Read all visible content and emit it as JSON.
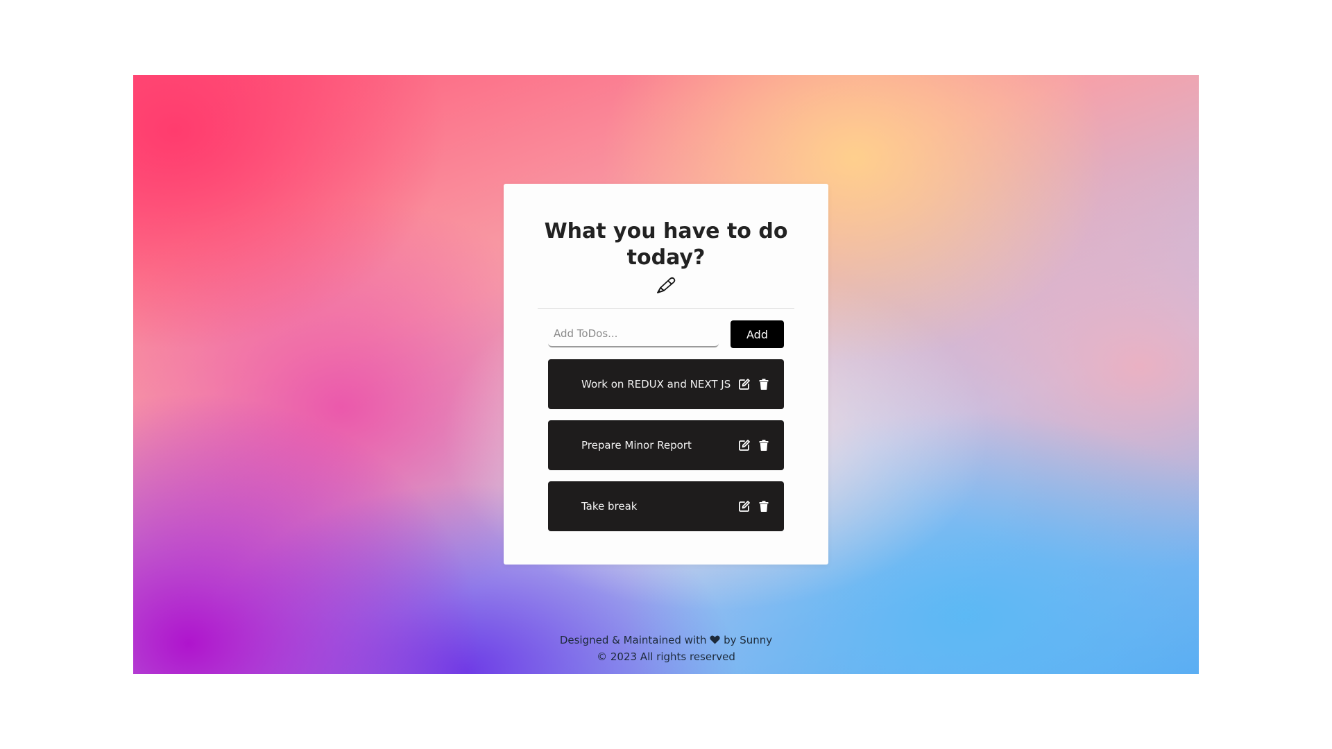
{
  "card": {
    "title": "What you have to do today?",
    "title_icon": "pen-icon"
  },
  "form": {
    "input_placeholder": "Add ToDos...",
    "input_value": "",
    "add_label": "Add"
  },
  "todos": [
    {
      "text": "Work on REDUX and NEXT JS",
      "edit_icon": "edit-icon",
      "delete_icon": "trash-icon"
    },
    {
      "text": "Prepare Minor Report",
      "edit_icon": "edit-icon",
      "delete_icon": "trash-icon"
    },
    {
      "text": "Take break",
      "edit_icon": "edit-icon",
      "delete_icon": "trash-icon"
    }
  ],
  "footer": {
    "line1_prefix": "Designed & Maintained with",
    "line1_icon": "heart-icon",
    "line1_suffix": "by Sunny",
    "line2": "© 2023 All rights reserved"
  },
  "colors": {
    "item_bg": "#1e1c1c",
    "button_bg": "#000000",
    "card_bg": "#fdfdfd"
  }
}
